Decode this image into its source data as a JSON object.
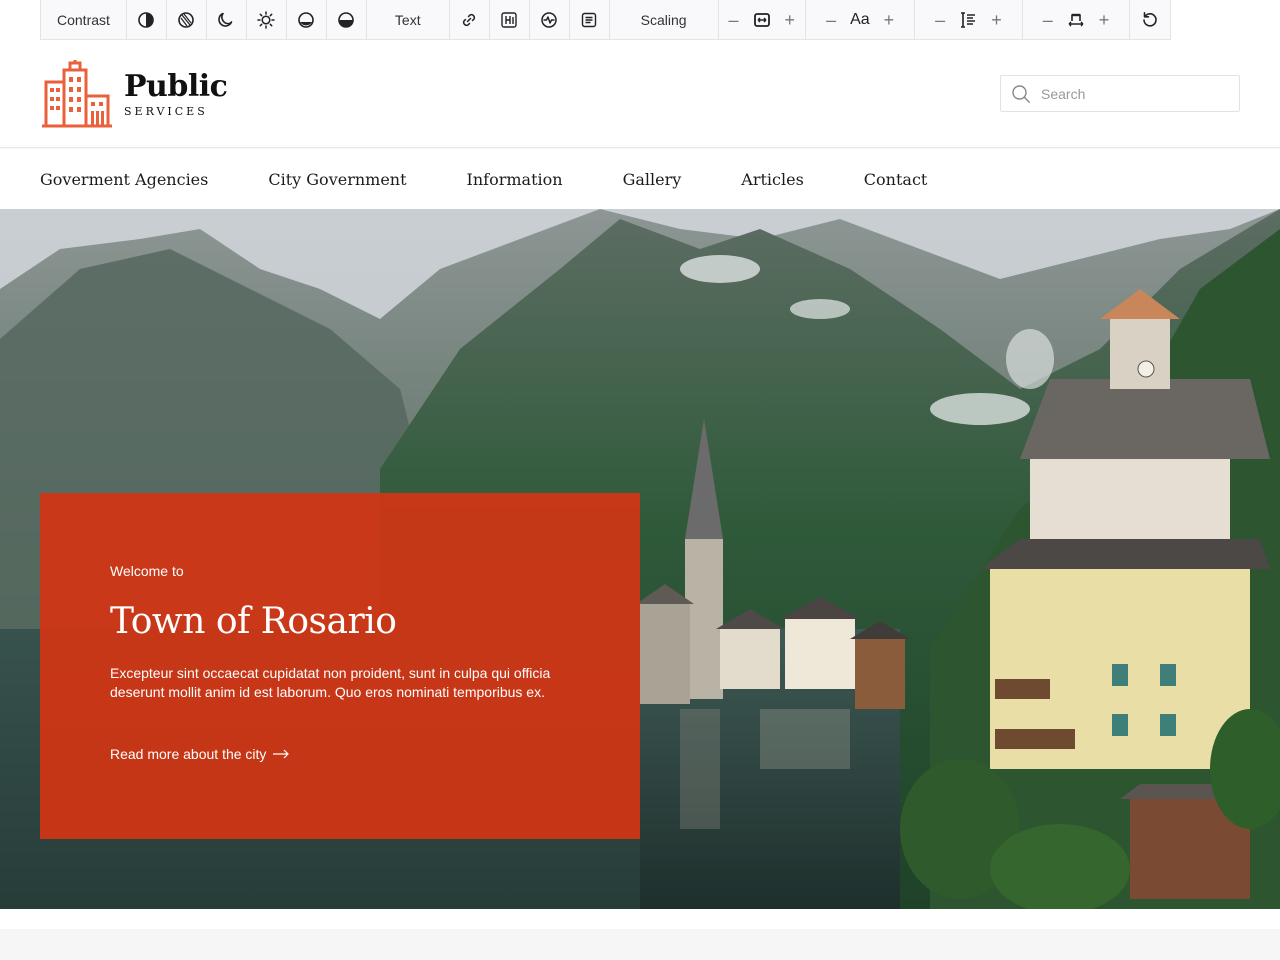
{
  "toolbar": {
    "contrast_label": "Contrast",
    "text_label": "Text",
    "scaling_label": "Scaling",
    "font_sample": "Aa",
    "minus": "–",
    "plus": "+"
  },
  "header": {
    "logo_title": "Public",
    "logo_subtitle": "SERVICES",
    "search_placeholder": "Search"
  },
  "nav": {
    "items": [
      "Goverment Agencies",
      "City Government",
      "Information",
      "Gallery",
      "Articles",
      "Contact"
    ]
  },
  "hero": {
    "kicker": "Welcome to",
    "title": "Town of Rosario",
    "text": "Excepteur sint occaecat cupidatat non proident, sunt in culpa qui officia deserunt mollit anim id est laborum. Quo eros nominati temporibus ex.",
    "link": "Read more about the city"
  },
  "colors": {
    "accent": "#e04b1f",
    "card": "#d63412"
  }
}
